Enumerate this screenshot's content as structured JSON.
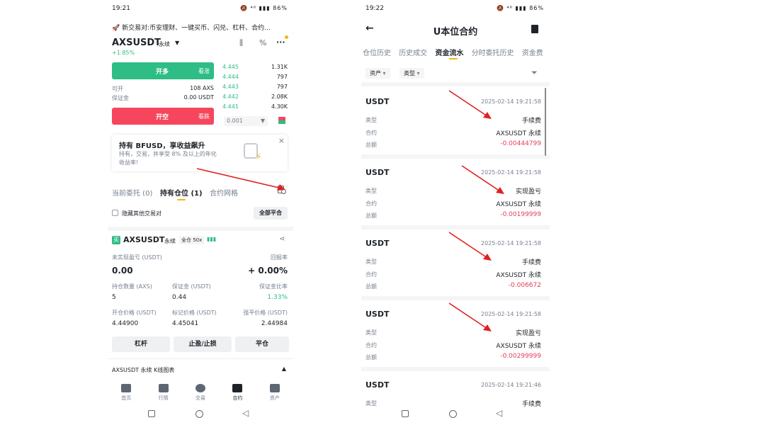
{
  "left": {
    "status": {
      "time": "19:21",
      "icons": "🔕 ⁴⁶ ▮▮▮ 86%",
      "battery": "86%"
    },
    "banner": {
      "icon": "🚀",
      "text": "新交易对:币安理财、一键买币、闪兑、杠杆、合约..."
    },
    "header": {
      "symbol": "AXSUSDT",
      "type": "永续",
      "change": "+1.85%",
      "menu": "···"
    },
    "order": {
      "long_label": "开多",
      "long_tag": "看涨",
      "short_label": "开空",
      "short_tag": "看跌",
      "available_label": "可开",
      "available_value": "108 AXS",
      "margin_label": "保证金",
      "margin_value": "0.00 USDT",
      "step_value": "0.001"
    },
    "orderbook": [
      {
        "price": "4.445",
        "qty": "1.31K"
      },
      {
        "price": "4.444",
        "qty": "797"
      },
      {
        "price": "4.443",
        "qty": "797"
      },
      {
        "price": "4.442",
        "qty": "2.08K"
      },
      {
        "price": "4.441",
        "qty": "4.30K"
      }
    ],
    "promo": {
      "title": "持有 BFUSD，享收益飙升",
      "line1": "持有，交易，并享受 8% 及以上的年化",
      "line2": "收益率!",
      "close": "×"
    },
    "tabs": [
      {
        "label": "当前委托 (0)"
      },
      {
        "label": "持有仓位 (1)"
      },
      {
        "label": "合约网格"
      }
    ],
    "hide_other": "隐藏其他交易对",
    "close_all": "全部平合",
    "position": {
      "side_badge": "买",
      "symbol": "AXSUSDT",
      "type": "永续",
      "mode": "全仓 50x",
      "pnl_label": "未实现盈亏 (USDT)",
      "pnl_value": "0.00",
      "roe_label": "回报率",
      "roe_value": "+ 0.00%",
      "qty_label": "持仓数量 (AXS)",
      "qty_value": "5",
      "margin_label": "保证金 (USDT)",
      "margin_value": "0.44",
      "ratio_label": "保证金比率",
      "ratio_value": "1.33%",
      "entry_label": "开仓价格 (USDT)",
      "entry_value": "4.44900",
      "mark_label": "标记价格 (USDT)",
      "mark_value": "4.45041",
      "liq_label": "强平价格 (USDT)",
      "liq_value": "2.44984",
      "btn_leverage": "杠杆",
      "btn_tpsl": "止盈/止损",
      "btn_close": "平仓"
    },
    "kline_bar": "AXSUSDT 永续 K线图表",
    "nav": [
      {
        "label": "首页"
      },
      {
        "label": "行情"
      },
      {
        "label": "交易"
      },
      {
        "label": "合约"
      },
      {
        "label": "资产"
      }
    ]
  },
  "right": {
    "status": {
      "time": "19:22",
      "icons": "🔕 ⁴⁶ ▮▮▮ 86%"
    },
    "title": "U本位合约",
    "tabs": [
      {
        "label": "仓位历史"
      },
      {
        "label": "历史成交"
      },
      {
        "label": "资金流水"
      },
      {
        "label": "分时委托历史"
      },
      {
        "label": "资金费"
      }
    ],
    "filters": {
      "asset": "资产",
      "type": "类型"
    },
    "field_labels": {
      "type": "类型",
      "contract": "合约",
      "amount": "总额"
    },
    "records": [
      {
        "currency": "USDT",
        "time": "2025-02-14 19:21:58",
        "type": "手续费",
        "contract": "AXSUSDT 永续",
        "amount": "-0.00444799"
      },
      {
        "currency": "USDT",
        "time": "2025-02-14 19:21:58",
        "type": "实现盈亏",
        "contract": "AXSUSDT 永续",
        "amount": "-0.00199999"
      },
      {
        "currency": "USDT",
        "time": "2025-02-14 19:21:58",
        "type": "手续费",
        "contract": "AXSUSDT 永续",
        "amount": "-0.006672"
      },
      {
        "currency": "USDT",
        "time": "2025-02-14 19:21:58",
        "type": "实现盈亏",
        "contract": "AXSUSDT 永续",
        "amount": "-0.00299999"
      },
      {
        "currency": "USDT",
        "time": "2025-02-14 19:21:46",
        "type": "手续费",
        "contract": "",
        "amount": ""
      }
    ]
  },
  "colors": {
    "green": "#2ebd85",
    "red": "#f6465d",
    "accent": "#f0b90b",
    "annotation": "#e02020"
  }
}
